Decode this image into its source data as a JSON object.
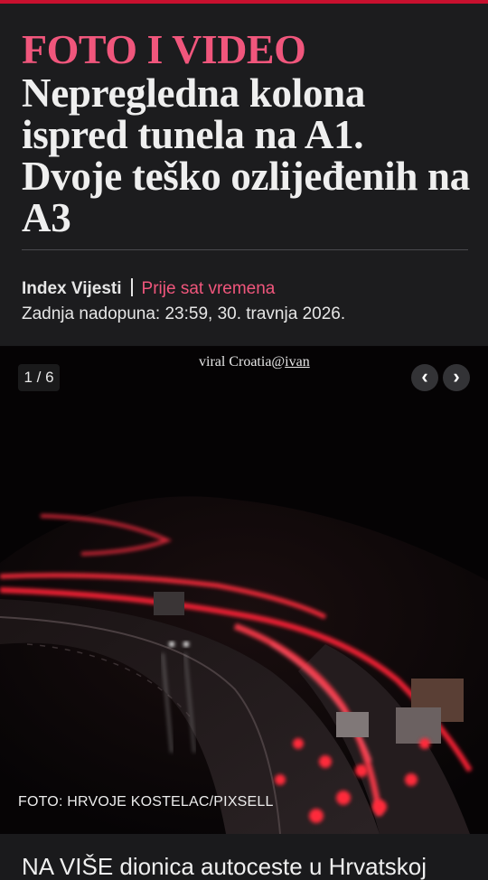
{
  "article": {
    "kicker": "FOTO I VIDEO",
    "headline": "Nepregledna kolona ispred tunela na A1. Dvoje teško ozlijeđenih na A3",
    "source": "Index Vijesti",
    "published": "Prije sat vremena",
    "updated": "Zadnja nadopuna: 23:59, 30. travnja 2026."
  },
  "gallery": {
    "counter": "1 / 6",
    "watermark_text": "viral Croatia@",
    "watermark_handle": "ivan",
    "prev_icon": "chevron-left-icon",
    "next_icon": "chevron-right-icon",
    "prev_glyph": "‹",
    "next_glyph": "›",
    "credit": "FOTO: HRVOJE KOSTELAC/PIXSELL"
  },
  "lead_text": "NA VIŠE dionica autoceste u Hrvatskoj",
  "colors": {
    "accent": "#f0567c",
    "brand_bar": "#c8102e",
    "background": "#1c1c1e"
  }
}
